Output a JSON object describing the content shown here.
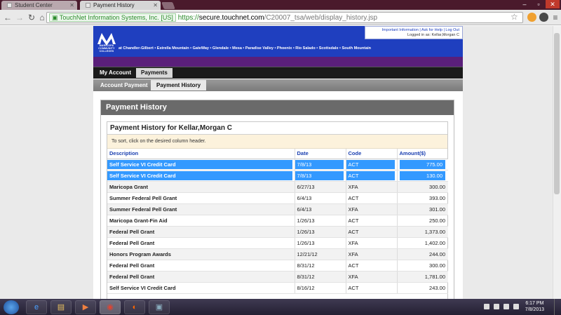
{
  "browser": {
    "tabs": [
      {
        "title": "Student Center",
        "active": false
      },
      {
        "title": "Payment History",
        "active": true
      }
    ],
    "ev_cert": "TouchNet Information Systems, Inc. [US]",
    "url_scheme": "https://",
    "url_host": "secure.touchnet.com",
    "url_path": "/C20007_tsa/web/display_history.jsp"
  },
  "site": {
    "logo_text": "MARICOPA COMMUNITY COLLEGES",
    "campuses": "at Chandler-Gilbert • Estrella Mountain • GateWay • Glendale • Mesa • Paradise Valley • Phoenix • Rio Salado • Scottsdale • South Mountain",
    "user_links": "Important Information | Ask for Help | Log Out",
    "logged_in_as": "Logged in as: Kellar,Morgan C",
    "main_nav": [
      "My Account",
      "Payments"
    ],
    "sub_nav": [
      "Account Payment",
      "Payment History"
    ]
  },
  "panel": {
    "title": "Payment History",
    "inner_title": "Payment History for Kellar,Morgan C",
    "note": "To sort, click on the desired column header.",
    "columns": [
      "Description",
      "Date",
      "Code",
      "Amount($)"
    ],
    "rows": [
      {
        "desc": "Self Service VI Credit Card",
        "date": "7/8/13",
        "code": "ACT",
        "amount": "775.00",
        "selected": true
      },
      {
        "desc": "Self Service VI Credit Card",
        "date": "7/8/13",
        "code": "ACT",
        "amount": "130.00",
        "selected": true
      },
      {
        "desc": "Maricopa Grant",
        "date": "6/27/13",
        "code": "XFA",
        "amount": "300.00"
      },
      {
        "desc": "Summer Federal Pell Grant",
        "date": "6/4/13",
        "code": "ACT",
        "amount": "393.00"
      },
      {
        "desc": "Summer Federal Pell Grant",
        "date": "6/4/13",
        "code": "XFA",
        "amount": "301.00"
      },
      {
        "desc": "Maricopa Grant-Fin Aid",
        "date": "1/26/13",
        "code": "ACT",
        "amount": "250.00"
      },
      {
        "desc": "Federal Pell Grant",
        "date": "1/26/13",
        "code": "ACT",
        "amount": "1,373.00"
      },
      {
        "desc": "Federal Pell Grant",
        "date": "1/26/13",
        "code": "XFA",
        "amount": "1,402.00"
      },
      {
        "desc": "Honors Program Awards",
        "date": "12/21/12",
        "code": "XFA",
        "amount": "244.00"
      },
      {
        "desc": "Federal Pell Grant",
        "date": "8/31/12",
        "code": "ACT",
        "amount": "300.00"
      },
      {
        "desc": "Federal Pell Grant",
        "date": "8/31/12",
        "code": "XFA",
        "amount": "1,781.00"
      },
      {
        "desc": "Self Service VI Credit Card",
        "date": "8/16/12",
        "code": "ACT",
        "amount": "243.00"
      }
    ]
  },
  "taskbar": {
    "time": "6:17 PM",
    "date": "7/8/2013"
  },
  "colors": {
    "banner": "#1f3fbf",
    "purple_bar": "#5a1f7a",
    "selection": "#3399ff",
    "header_link": "#1a3fb0"
  }
}
